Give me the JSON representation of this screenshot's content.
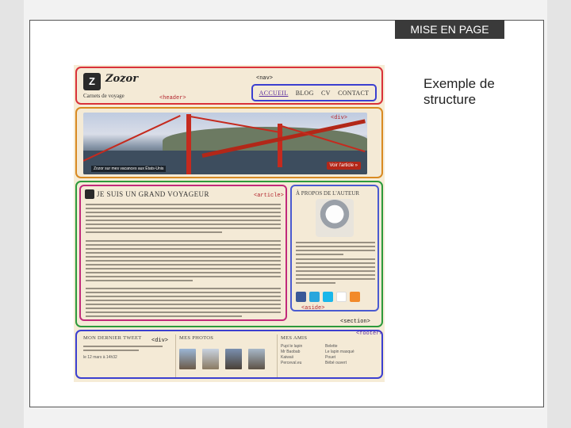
{
  "slide": {
    "title": "MISE EN PAGE",
    "caption": "Exemple de structure"
  },
  "site": {
    "logo_letter": "Z",
    "brand": "Zozor",
    "tagline": "Carnets de voyage",
    "nav": [
      "ACCUEIL",
      "BLOG",
      "CV",
      "CONTACT"
    ],
    "banner_caption": "Zozor sur mes vacances aux États-Unis",
    "banner_button": "Voir l'article »",
    "article_title": "JE SUIS UN GRAND VOYAGEUR",
    "aside_title": "À PROPOS DE L'AUTEUR",
    "footer": {
      "tweet_title": "MON DERNIER TWEET",
      "tweet_date": "le 12 mars à 14h32",
      "photos_title": "MES PHOTOS",
      "friends_title": "MES AMIS",
      "friends_col1": [
        "Pupi le lapin",
        "Mr Baobab",
        "Kaiwaii",
        "Perceval.eu"
      ],
      "friends_col2": [
        "Belette",
        "Le lapin masqué",
        "Pouet",
        "Bébé ouvert"
      ]
    }
  },
  "tags": {
    "nav": "<nav>",
    "header": "<header>",
    "div": "<div>",
    "article": "<article>",
    "aside": "<aside>",
    "section": "<section>",
    "footer": "<footer>",
    "div2": "<div>"
  },
  "colors": {
    "header": "#d9323a",
    "nav": "#3b3fd0",
    "div": "#d98a22",
    "section": "#2d9a3c",
    "article": "#c12a7a",
    "aside": "#4a5ad0",
    "footer": "#3b3fd0"
  }
}
